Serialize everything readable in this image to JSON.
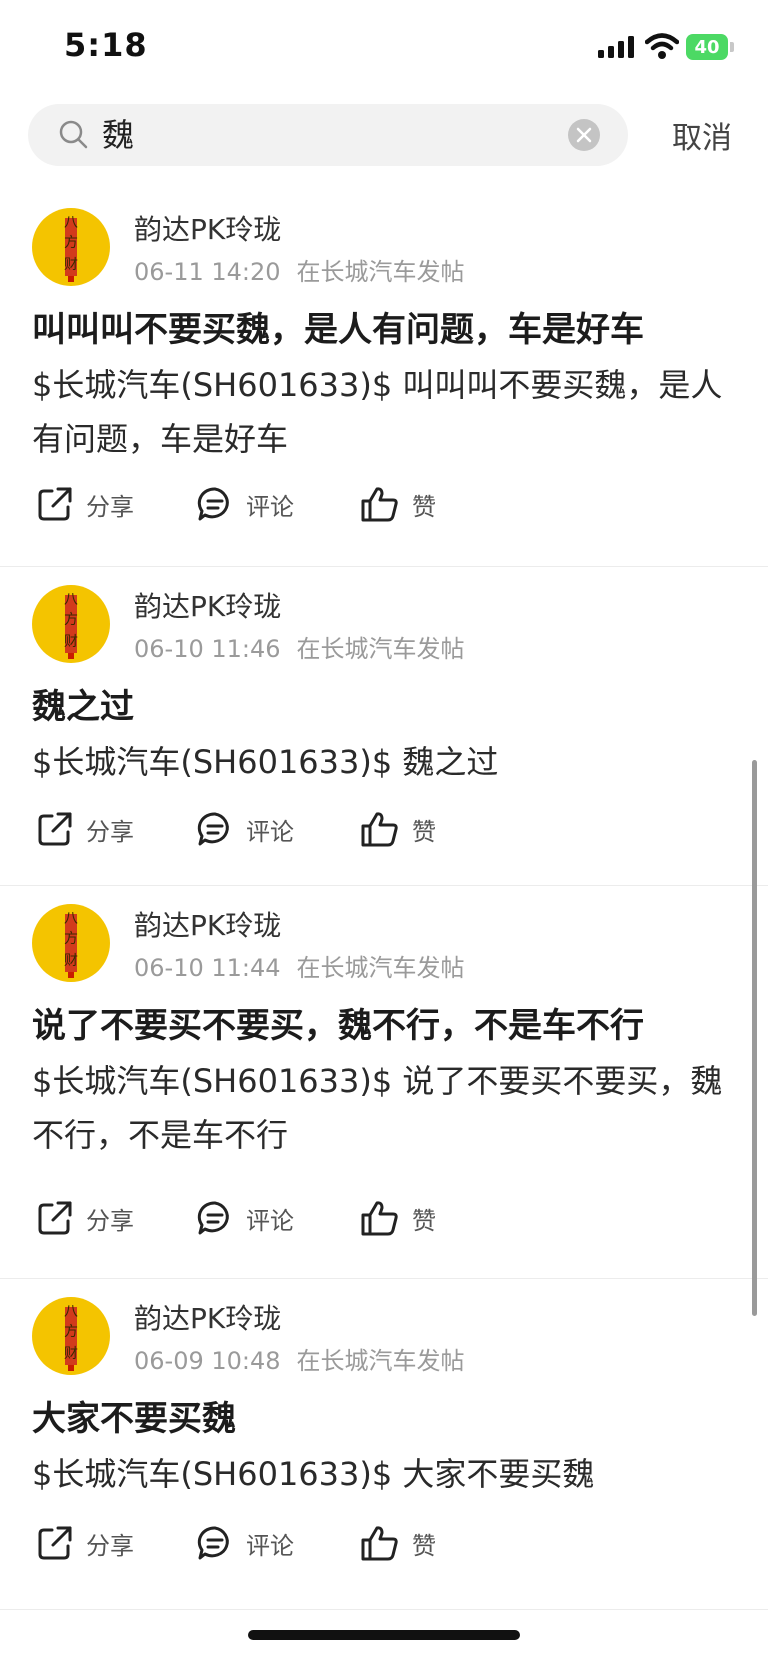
{
  "status_bar": {
    "time": "5:18",
    "battery": "40"
  },
  "search": {
    "value": "魏",
    "cancel_label": "取消"
  },
  "posts": [
    {
      "user": "韵达PK玲珑",
      "time": "06-11 14:20",
      "source": "在长城汽车发帖",
      "title": "叫叫叫不要买魏，是人有问题，车是好车",
      "body": "$长城汽车(SH601633)$ 叫叫叫不要买魏，是人有问题，车是好车",
      "actions": {
        "share": "分享",
        "comment": "评论",
        "like": "赞"
      }
    },
    {
      "user": "韵达PK玲珑",
      "time": "06-10 11:46",
      "source": "在长城汽车发帖",
      "title": "魏之过",
      "body": "$长城汽车(SH601633)$ 魏之过",
      "actions": {
        "share": "分享",
        "comment": "评论",
        "like": "赞"
      }
    },
    {
      "user": "韵达PK玲珑",
      "time": "06-10 11:44",
      "source": "在长城汽车发帖",
      "title": "说了不要买不要买，魏不行，不是车不行",
      "body": "$长城汽车(SH601633)$ 说了不要买不要买，魏不行，不是车不行",
      "actions": {
        "share": "分享",
        "comment": "评论",
        "like": "赞"
      }
    },
    {
      "user": "韵达PK玲珑",
      "time": "06-09 10:48",
      "source": "在长城汽车发帖",
      "title": "大家不要买魏",
      "body": "$长城汽车(SH601633)$ 大家不要买魏",
      "actions": {
        "share": "分享",
        "comment": "评论",
        "like": "赞"
      }
    }
  ],
  "avatar_text": [
    "八",
    "方",
    "财"
  ],
  "colors": {
    "accent_yellow": "#f4c400",
    "battery_green": "#4cd964"
  }
}
